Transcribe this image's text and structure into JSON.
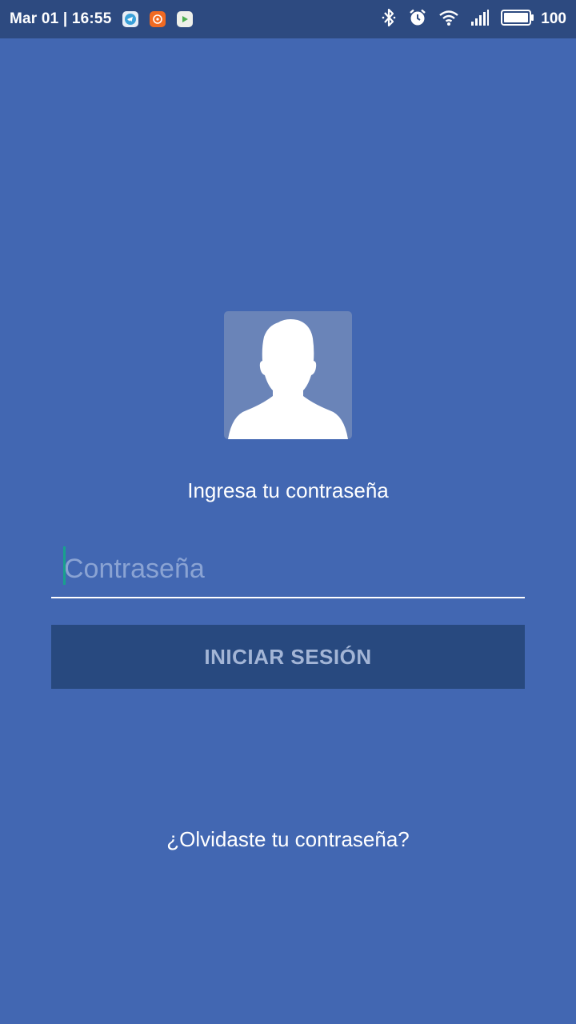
{
  "status_bar": {
    "time": "Mar 01 | 16:55",
    "battery": "100",
    "notification_icons": [
      "telegram-icon",
      "orange-app-icon",
      "play-icon"
    ],
    "system_icons": [
      "bluetooth-icon",
      "alarm-icon",
      "wifi-icon",
      "signal-icon",
      "battery-icon"
    ]
  },
  "login": {
    "prompt": "Ingresa tu contraseña",
    "password_placeholder": "Contraseña",
    "password_value": "",
    "login_button": "INICIAR SESIÓN",
    "forgot_password": "¿Olvidaste tu contraseña?"
  },
  "colors": {
    "background": "#4267b2",
    "status_bar": "#2d4a80",
    "button": "#28497f",
    "button_text": "#a3b5d6",
    "caret": "#19a08d"
  }
}
